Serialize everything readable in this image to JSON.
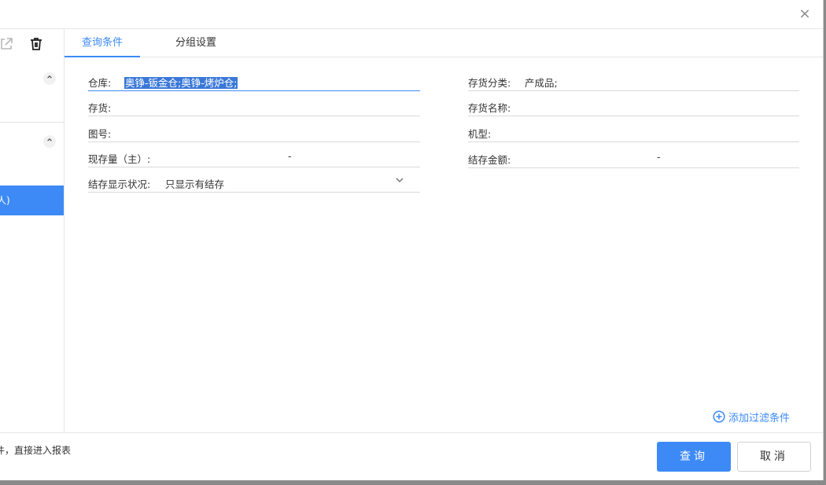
{
  "dialog": {
    "close_glyph": "×"
  },
  "left_panel": {
    "selected_item": "人)"
  },
  "tabs": [
    {
      "label": "查询条件",
      "active": true
    },
    {
      "label": "分组设置",
      "active": false
    }
  ],
  "fields": {
    "warehouse": {
      "label": "仓库:",
      "value": "奥铮-钣金仓;奥铮-烤炉仓;"
    },
    "inventory_category": {
      "label": "存货分类:",
      "value": "产成品;"
    },
    "inventory": {
      "label": "存货:",
      "value": ""
    },
    "inventory_name": {
      "label": "存货名称:",
      "value": ""
    },
    "drawing_no": {
      "label": "图号:",
      "value": ""
    },
    "model": {
      "label": "机型:",
      "value": ""
    },
    "current_qty": {
      "label": "现存量（主）:",
      "value": "-"
    },
    "balance_amount": {
      "label": "结存金额:",
      "value": "-"
    },
    "balance_display": {
      "label": "结存显示状况:",
      "value": "只显示有结存"
    }
  },
  "add_filter_label": "添加过滤条件",
  "footer": {
    "note": "件，直接进入报表",
    "query_label": "查询",
    "cancel_label": "取消"
  },
  "colors": {
    "accent": "#3d8af7"
  },
  "icons": [
    "close-icon",
    "external-link-icon",
    "trash-icon",
    "chevron-up-icon",
    "chevron-down-icon",
    "plus-circle-icon"
  ]
}
